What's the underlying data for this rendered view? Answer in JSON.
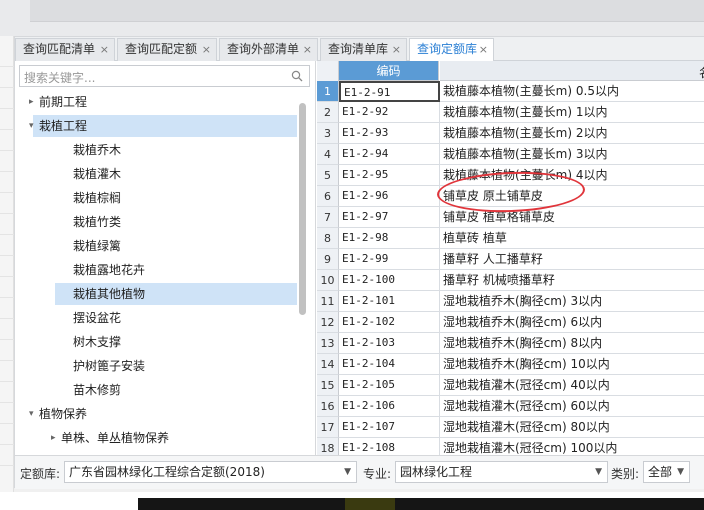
{
  "tabs": [
    {
      "label": "查询匹配清单",
      "close": "×"
    },
    {
      "label": "查询匹配定额",
      "close": "×"
    },
    {
      "label": "查询外部清单",
      "close": "×"
    },
    {
      "label": "查询清单库",
      "close": "×"
    },
    {
      "label": "查询定额库",
      "close": "×",
      "active": true
    }
  ],
  "search": {
    "placeholder": "搜索关键字..."
  },
  "tree": [
    {
      "label": "前期工程",
      "arrow": "▸"
    },
    {
      "label": "栽植工程",
      "arrow": "▾"
    },
    {
      "label": "栽植乔木"
    },
    {
      "label": "栽植灌木"
    },
    {
      "label": "栽植棕榈"
    },
    {
      "label": "栽植竹类"
    },
    {
      "label": "栽植绿篱"
    },
    {
      "label": "栽植露地花卉"
    },
    {
      "label": "栽植其他植物"
    },
    {
      "label": "摆设盆花"
    },
    {
      "label": "树木支撑"
    },
    {
      "label": "护树篦子安装"
    },
    {
      "label": "苗木修剪"
    },
    {
      "label": "植物保养",
      "arrow": "▾"
    },
    {
      "label": "单株、单丛植物保养",
      "arrow": "▸"
    }
  ],
  "grid": {
    "col_code": "编码",
    "col_name_partial": "名",
    "rows": [
      {
        "n": "1",
        "code": "E1-2-91",
        "name": "栽植藤本植物(主蔓长m) 0.5以内"
      },
      {
        "n": "2",
        "code": "E1-2-92",
        "name": "栽植藤本植物(主蔓长m) 1以内"
      },
      {
        "n": "3",
        "code": "E1-2-93",
        "name": "栽植藤本植物(主蔓长m) 2以内"
      },
      {
        "n": "4",
        "code": "E1-2-94",
        "name": "栽植藤本植物(主蔓长m) 3以内"
      },
      {
        "n": "5",
        "code": "E1-2-95",
        "name": "栽植藤本植物(主蔓长m) 4以内"
      },
      {
        "n": "6",
        "code": "E1-2-96",
        "name": "铺草皮 原土铺草皮"
      },
      {
        "n": "7",
        "code": "E1-2-97",
        "name": "铺草皮 植草格铺草皮"
      },
      {
        "n": "8",
        "code": "E1-2-98",
        "name": "植草砖 植草"
      },
      {
        "n": "9",
        "code": "E1-2-99",
        "name": "播草籽 人工播草籽"
      },
      {
        "n": "10",
        "code": "E1-2-100",
        "name": "播草籽 机械喷播草籽"
      },
      {
        "n": "11",
        "code": "E1-2-101",
        "name": "湿地栽植乔木(胸径cm) 3以内"
      },
      {
        "n": "12",
        "code": "E1-2-102",
        "name": "湿地栽植乔木(胸径cm) 6以内"
      },
      {
        "n": "13",
        "code": "E1-2-103",
        "name": "湿地栽植乔木(胸径cm) 8以内"
      },
      {
        "n": "14",
        "code": "E1-2-104",
        "name": "湿地栽植乔木(胸径cm) 10以内"
      },
      {
        "n": "15",
        "code": "E1-2-105",
        "name": "湿地栽植灌木(冠径cm) 40以内"
      },
      {
        "n": "16",
        "code": "E1-2-106",
        "name": "湿地栽植灌木(冠径cm) 60以内"
      },
      {
        "n": "17",
        "code": "E1-2-107",
        "name": "湿地栽植灌木(冠径cm) 80以内"
      },
      {
        "n": "18",
        "code": "E1-2-108",
        "name": "湿地栽植灌木(冠径cm) 100以内"
      }
    ]
  },
  "filters": {
    "quota_label": "定额库:",
    "quota_value": "广东省园林绿化工程综合定额(2018)",
    "major_label": "专业:",
    "major_value": "园林绿化工程",
    "category_label": "类别:",
    "category_value": "全部"
  },
  "colors": {
    "accent": "#5b9bd5",
    "selected_bg": "#cfe3f7",
    "highlight_circle": "#e0353b"
  }
}
